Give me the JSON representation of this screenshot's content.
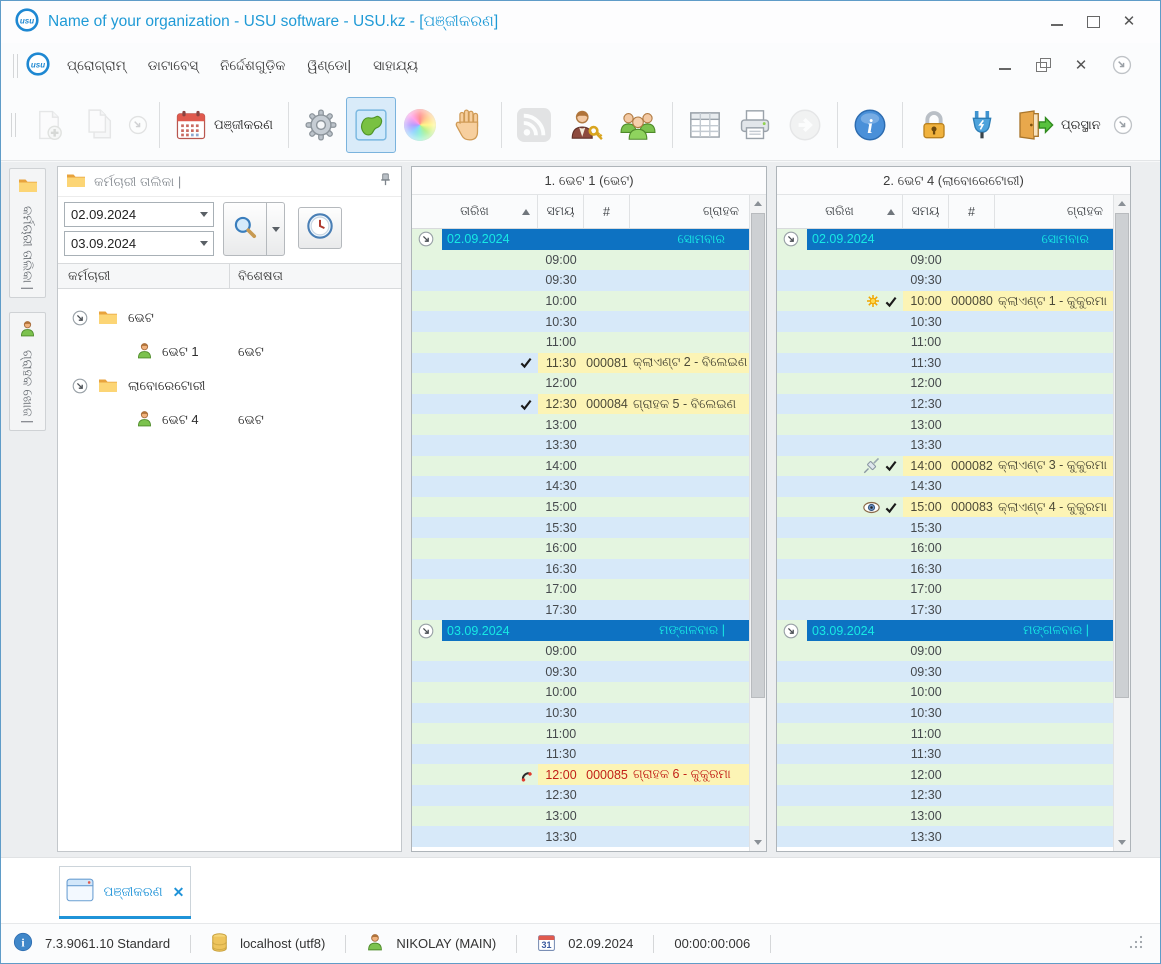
{
  "window": {
    "title": "Name of your organization - USU software - USU.kz - [ପଞ୍ଜୀକରଣ]"
  },
  "menu": {
    "items": [
      "ପ୍ରୋଗ୍ରାମ୍",
      "ଡାଟାବେସ୍",
      "ନିର୍ଦ୍ଦେଶଗୁଡ଼ିକ",
      "ୱିଣ୍ଡୋ|",
      "ସାହାଯ୍ୟ"
    ]
  },
  "toolbar": {
    "items": [
      {
        "icon": "add-document-icon",
        "disabled": true
      },
      {
        "icon": "copy-document-icon",
        "disabled": true
      },
      {
        "icon": "overflow-chevron-icon",
        "small": true,
        "disabled": true
      },
      {
        "sep": true
      },
      {
        "icon": "calendar-icon",
        "label": "ପଞ୍ଜୀକରଣ"
      },
      {
        "sep": true
      },
      {
        "icon": "settings-gear-icon"
      },
      {
        "icon": "map-icon",
        "active": true
      },
      {
        "icon": "color-wheel-icon"
      },
      {
        "icon": "hand-icon"
      },
      {
        "sep": true
      },
      {
        "icon": "rss-icon",
        "disabled": true
      },
      {
        "icon": "user-key-icon"
      },
      {
        "icon": "users-group-icon"
      },
      {
        "sep": true
      },
      {
        "icon": "table-icon"
      },
      {
        "icon": "printer-icon"
      },
      {
        "icon": "next-arrow-icon",
        "disabled": true
      },
      {
        "sep": true
      },
      {
        "icon": "info-icon"
      },
      {
        "sep": true
      },
      {
        "icon": "lock-icon"
      },
      {
        "icon": "plug-icon"
      },
      {
        "icon": "exit-door-icon",
        "label": "ପ୍ରସ୍ଥାନ"
      },
      {
        "icon": "overflow-chevron-icon",
        "small": true
      }
    ]
  },
  "sidebar": {
    "tabs": [
      {
        "icon": "folder-icon",
        "label": "କର୍ମଚାରୀ ତାଲିକା |"
      },
      {
        "icon": "person-icon",
        "label": "ଗ୍ରାହକ ଖୋଜ |"
      }
    ]
  },
  "left_panel": {
    "title": "କର୍ମଚାରୀ ତାଲିକା |",
    "date_from": "02.09.2024",
    "date_to": "03.09.2024",
    "columns": [
      "କର୍ମଚାରୀ",
      "ବିଶେଷତା"
    ],
    "tree": [
      {
        "type": "folder",
        "label": "ଭେଟ"
      },
      {
        "type": "person",
        "label": "ଭେଟ 1",
        "spec": "ଭେଟ"
      },
      {
        "type": "folder",
        "label": "ଲାବୋରେଟୋରୀ"
      },
      {
        "type": "person",
        "label": "ଭେଟ 4",
        "spec": "ଭେଟ"
      }
    ]
  },
  "schedules": {
    "columns": [
      "ତାରିଖ",
      "ସମୟ",
      "#",
      "ଗ୍ରାହକ"
    ],
    "panels": [
      {
        "title": "1. ଭେଟ 1 (ଭେଟ)",
        "sections": [
          {
            "date": "02.09.2024",
            "day": "ସୋମବାର",
            "slots": [
              {
                "t": "09:00"
              },
              {
                "t": "09:30"
              },
              {
                "t": "10:00"
              },
              {
                "t": "10:30"
              },
              {
                "t": "11:00"
              },
              {
                "t": "11:30",
                "n": "000081",
                "c": "କ୍ଲାଏଣ୍ଟ 2 - ବିଲେଇଣ",
                "icons": [
                  "check"
                ]
              },
              {
                "t": "12:00"
              },
              {
                "t": "12:30",
                "n": "000084",
                "c": "ଗ୍ରାହକ 5 - ବିଲେଇଣ",
                "icons": [
                  "check"
                ]
              },
              {
                "t": "13:00"
              },
              {
                "t": "13:30"
              },
              {
                "t": "14:00"
              },
              {
                "t": "14:30"
              },
              {
                "t": "15:00"
              },
              {
                "t": "15:30"
              },
              {
                "t": "16:00"
              },
              {
                "t": "16:30"
              },
              {
                "t": "17:00"
              },
              {
                "t": "17:30"
              }
            ]
          },
          {
            "date": "03.09.2024",
            "day": "ମଙ୍ଗଳବାର |",
            "slots": [
              {
                "t": "09:00"
              },
              {
                "t": "09:30"
              },
              {
                "t": "10:00"
              },
              {
                "t": "10:30"
              },
              {
                "t": "11:00"
              },
              {
                "t": "11:30"
              },
              {
                "t": "12:00",
                "n": "000085",
                "c": "ଗ୍ରାହକ 6 - କୁକୁରମା",
                "icons": [
                  "phone"
                ],
                "red": true
              },
              {
                "t": "12:30"
              },
              {
                "t": "13:00"
              },
              {
                "t": "13:30"
              }
            ]
          }
        ]
      },
      {
        "title": "2. ଭେଟ 4 (ଲାବୋରେଟୋରୀ)",
        "sections": [
          {
            "date": "02.09.2024",
            "day": "ସୋମବାର",
            "slots": [
              {
                "t": "09:00"
              },
              {
                "t": "09:30"
              },
              {
                "t": "10:00",
                "n": "000080",
                "c": "କ୍ଲାଏଣ୍ଟ 1 - କୁକୁରମା",
                "icons": [
                  "star",
                  "check"
                ]
              },
              {
                "t": "10:30"
              },
              {
                "t": "11:00"
              },
              {
                "t": "11:30"
              },
              {
                "t": "12:00"
              },
              {
                "t": "12:30"
              },
              {
                "t": "13:00"
              },
              {
                "t": "13:30"
              },
              {
                "t": "14:00",
                "n": "000082",
                "c": "କ୍ଲାଏଣ୍ଟ 3 - କୁକୁରମା",
                "icons": [
                  "syringe",
                  "check"
                ]
              },
              {
                "t": "14:30"
              },
              {
                "t": "15:00",
                "n": "000083",
                "c": "କ୍ଲାଏଣ୍ଟ 4 - କୁକୁରମା",
                "icons": [
                  "eye",
                  "check"
                ]
              },
              {
                "t": "15:30"
              },
              {
                "t": "16:00"
              },
              {
                "t": "16:30"
              },
              {
                "t": "17:00"
              },
              {
                "t": "17:30"
              }
            ]
          },
          {
            "date": "03.09.2024",
            "day": "ମଙ୍ଗଳବାର |",
            "slots": [
              {
                "t": "09:00"
              },
              {
                "t": "09:30"
              },
              {
                "t": "10:00"
              },
              {
                "t": "10:30"
              },
              {
                "t": "11:00"
              },
              {
                "t": "11:30"
              },
              {
                "t": "12:00"
              },
              {
                "t": "12:30"
              },
              {
                "t": "13:00"
              },
              {
                "t": "13:30"
              }
            ]
          }
        ]
      }
    ]
  },
  "tabs": {
    "active_label": "ପଞ୍ଜୀକରଣ"
  },
  "statusbar": {
    "items": [
      {
        "icon": "info-circle-icon",
        "text": "7.3.9061.10 Standard"
      },
      {
        "sep": true
      },
      {
        "icon": "database-icon",
        "text": "localhost (utf8)"
      },
      {
        "sep": true
      },
      {
        "icon": "user-icon",
        "text": "NIKOLAY (MAIN)"
      },
      {
        "sep": true
      },
      {
        "icon": "calendar-31-icon",
        "text": "02.09.2024"
      },
      {
        "sep": true
      },
      {
        "text": "00:00:00:006"
      },
      {
        "sep": true
      }
    ]
  },
  "colors": {
    "accent_blue": "#1f9ad6",
    "band_blue": "#0d72c2",
    "band_text_cyan": "#17e9e4",
    "stripe_green": "#e4f5e0",
    "stripe_blue": "#d7e9f9",
    "appointment_yellow": "#fcf4b5",
    "appointment_red": "#c22018"
  }
}
